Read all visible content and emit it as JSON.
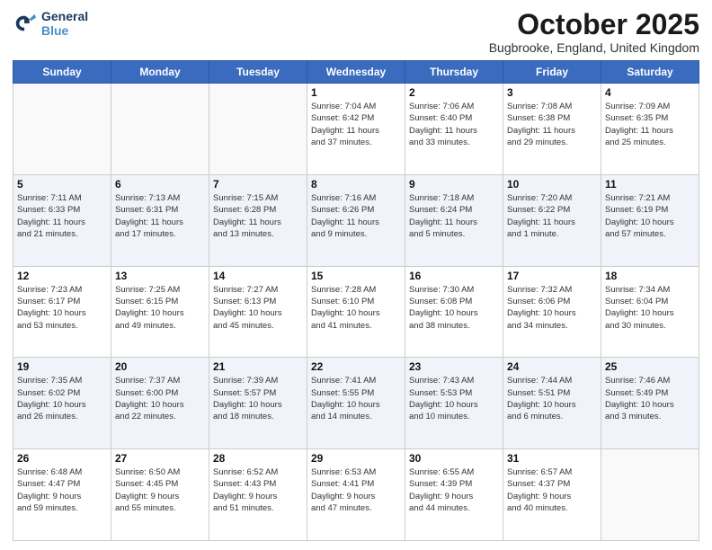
{
  "header": {
    "logo_line1": "General",
    "logo_line2": "Blue",
    "month": "October 2025",
    "location": "Bugbrooke, England, United Kingdom"
  },
  "days_of_week": [
    "Sunday",
    "Monday",
    "Tuesday",
    "Wednesday",
    "Thursday",
    "Friday",
    "Saturday"
  ],
  "weeks": [
    [
      {
        "day": "",
        "info": ""
      },
      {
        "day": "",
        "info": ""
      },
      {
        "day": "",
        "info": ""
      },
      {
        "day": "1",
        "info": "Sunrise: 7:04 AM\nSunset: 6:42 PM\nDaylight: 11 hours\nand 37 minutes."
      },
      {
        "day": "2",
        "info": "Sunrise: 7:06 AM\nSunset: 6:40 PM\nDaylight: 11 hours\nand 33 minutes."
      },
      {
        "day": "3",
        "info": "Sunrise: 7:08 AM\nSunset: 6:38 PM\nDaylight: 11 hours\nand 29 minutes."
      },
      {
        "day": "4",
        "info": "Sunrise: 7:09 AM\nSunset: 6:35 PM\nDaylight: 11 hours\nand 25 minutes."
      }
    ],
    [
      {
        "day": "5",
        "info": "Sunrise: 7:11 AM\nSunset: 6:33 PM\nDaylight: 11 hours\nand 21 minutes."
      },
      {
        "day": "6",
        "info": "Sunrise: 7:13 AM\nSunset: 6:31 PM\nDaylight: 11 hours\nand 17 minutes."
      },
      {
        "day": "7",
        "info": "Sunrise: 7:15 AM\nSunset: 6:28 PM\nDaylight: 11 hours\nand 13 minutes."
      },
      {
        "day": "8",
        "info": "Sunrise: 7:16 AM\nSunset: 6:26 PM\nDaylight: 11 hours\nand 9 minutes."
      },
      {
        "day": "9",
        "info": "Sunrise: 7:18 AM\nSunset: 6:24 PM\nDaylight: 11 hours\nand 5 minutes."
      },
      {
        "day": "10",
        "info": "Sunrise: 7:20 AM\nSunset: 6:22 PM\nDaylight: 11 hours\nand 1 minute."
      },
      {
        "day": "11",
        "info": "Sunrise: 7:21 AM\nSunset: 6:19 PM\nDaylight: 10 hours\nand 57 minutes."
      }
    ],
    [
      {
        "day": "12",
        "info": "Sunrise: 7:23 AM\nSunset: 6:17 PM\nDaylight: 10 hours\nand 53 minutes."
      },
      {
        "day": "13",
        "info": "Sunrise: 7:25 AM\nSunset: 6:15 PM\nDaylight: 10 hours\nand 49 minutes."
      },
      {
        "day": "14",
        "info": "Sunrise: 7:27 AM\nSunset: 6:13 PM\nDaylight: 10 hours\nand 45 minutes."
      },
      {
        "day": "15",
        "info": "Sunrise: 7:28 AM\nSunset: 6:10 PM\nDaylight: 10 hours\nand 41 minutes."
      },
      {
        "day": "16",
        "info": "Sunrise: 7:30 AM\nSunset: 6:08 PM\nDaylight: 10 hours\nand 38 minutes."
      },
      {
        "day": "17",
        "info": "Sunrise: 7:32 AM\nSunset: 6:06 PM\nDaylight: 10 hours\nand 34 minutes."
      },
      {
        "day": "18",
        "info": "Sunrise: 7:34 AM\nSunset: 6:04 PM\nDaylight: 10 hours\nand 30 minutes."
      }
    ],
    [
      {
        "day": "19",
        "info": "Sunrise: 7:35 AM\nSunset: 6:02 PM\nDaylight: 10 hours\nand 26 minutes."
      },
      {
        "day": "20",
        "info": "Sunrise: 7:37 AM\nSunset: 6:00 PM\nDaylight: 10 hours\nand 22 minutes."
      },
      {
        "day": "21",
        "info": "Sunrise: 7:39 AM\nSunset: 5:57 PM\nDaylight: 10 hours\nand 18 minutes."
      },
      {
        "day": "22",
        "info": "Sunrise: 7:41 AM\nSunset: 5:55 PM\nDaylight: 10 hours\nand 14 minutes."
      },
      {
        "day": "23",
        "info": "Sunrise: 7:43 AM\nSunset: 5:53 PM\nDaylight: 10 hours\nand 10 minutes."
      },
      {
        "day": "24",
        "info": "Sunrise: 7:44 AM\nSunset: 5:51 PM\nDaylight: 10 hours\nand 6 minutes."
      },
      {
        "day": "25",
        "info": "Sunrise: 7:46 AM\nSunset: 5:49 PM\nDaylight: 10 hours\nand 3 minutes."
      }
    ],
    [
      {
        "day": "26",
        "info": "Sunrise: 6:48 AM\nSunset: 4:47 PM\nDaylight: 9 hours\nand 59 minutes."
      },
      {
        "day": "27",
        "info": "Sunrise: 6:50 AM\nSunset: 4:45 PM\nDaylight: 9 hours\nand 55 minutes."
      },
      {
        "day": "28",
        "info": "Sunrise: 6:52 AM\nSunset: 4:43 PM\nDaylight: 9 hours\nand 51 minutes."
      },
      {
        "day": "29",
        "info": "Sunrise: 6:53 AM\nSunset: 4:41 PM\nDaylight: 9 hours\nand 47 minutes."
      },
      {
        "day": "30",
        "info": "Sunrise: 6:55 AM\nSunset: 4:39 PM\nDaylight: 9 hours\nand 44 minutes."
      },
      {
        "day": "31",
        "info": "Sunrise: 6:57 AM\nSunset: 4:37 PM\nDaylight: 9 hours\nand 40 minutes."
      },
      {
        "day": "",
        "info": ""
      }
    ]
  ]
}
